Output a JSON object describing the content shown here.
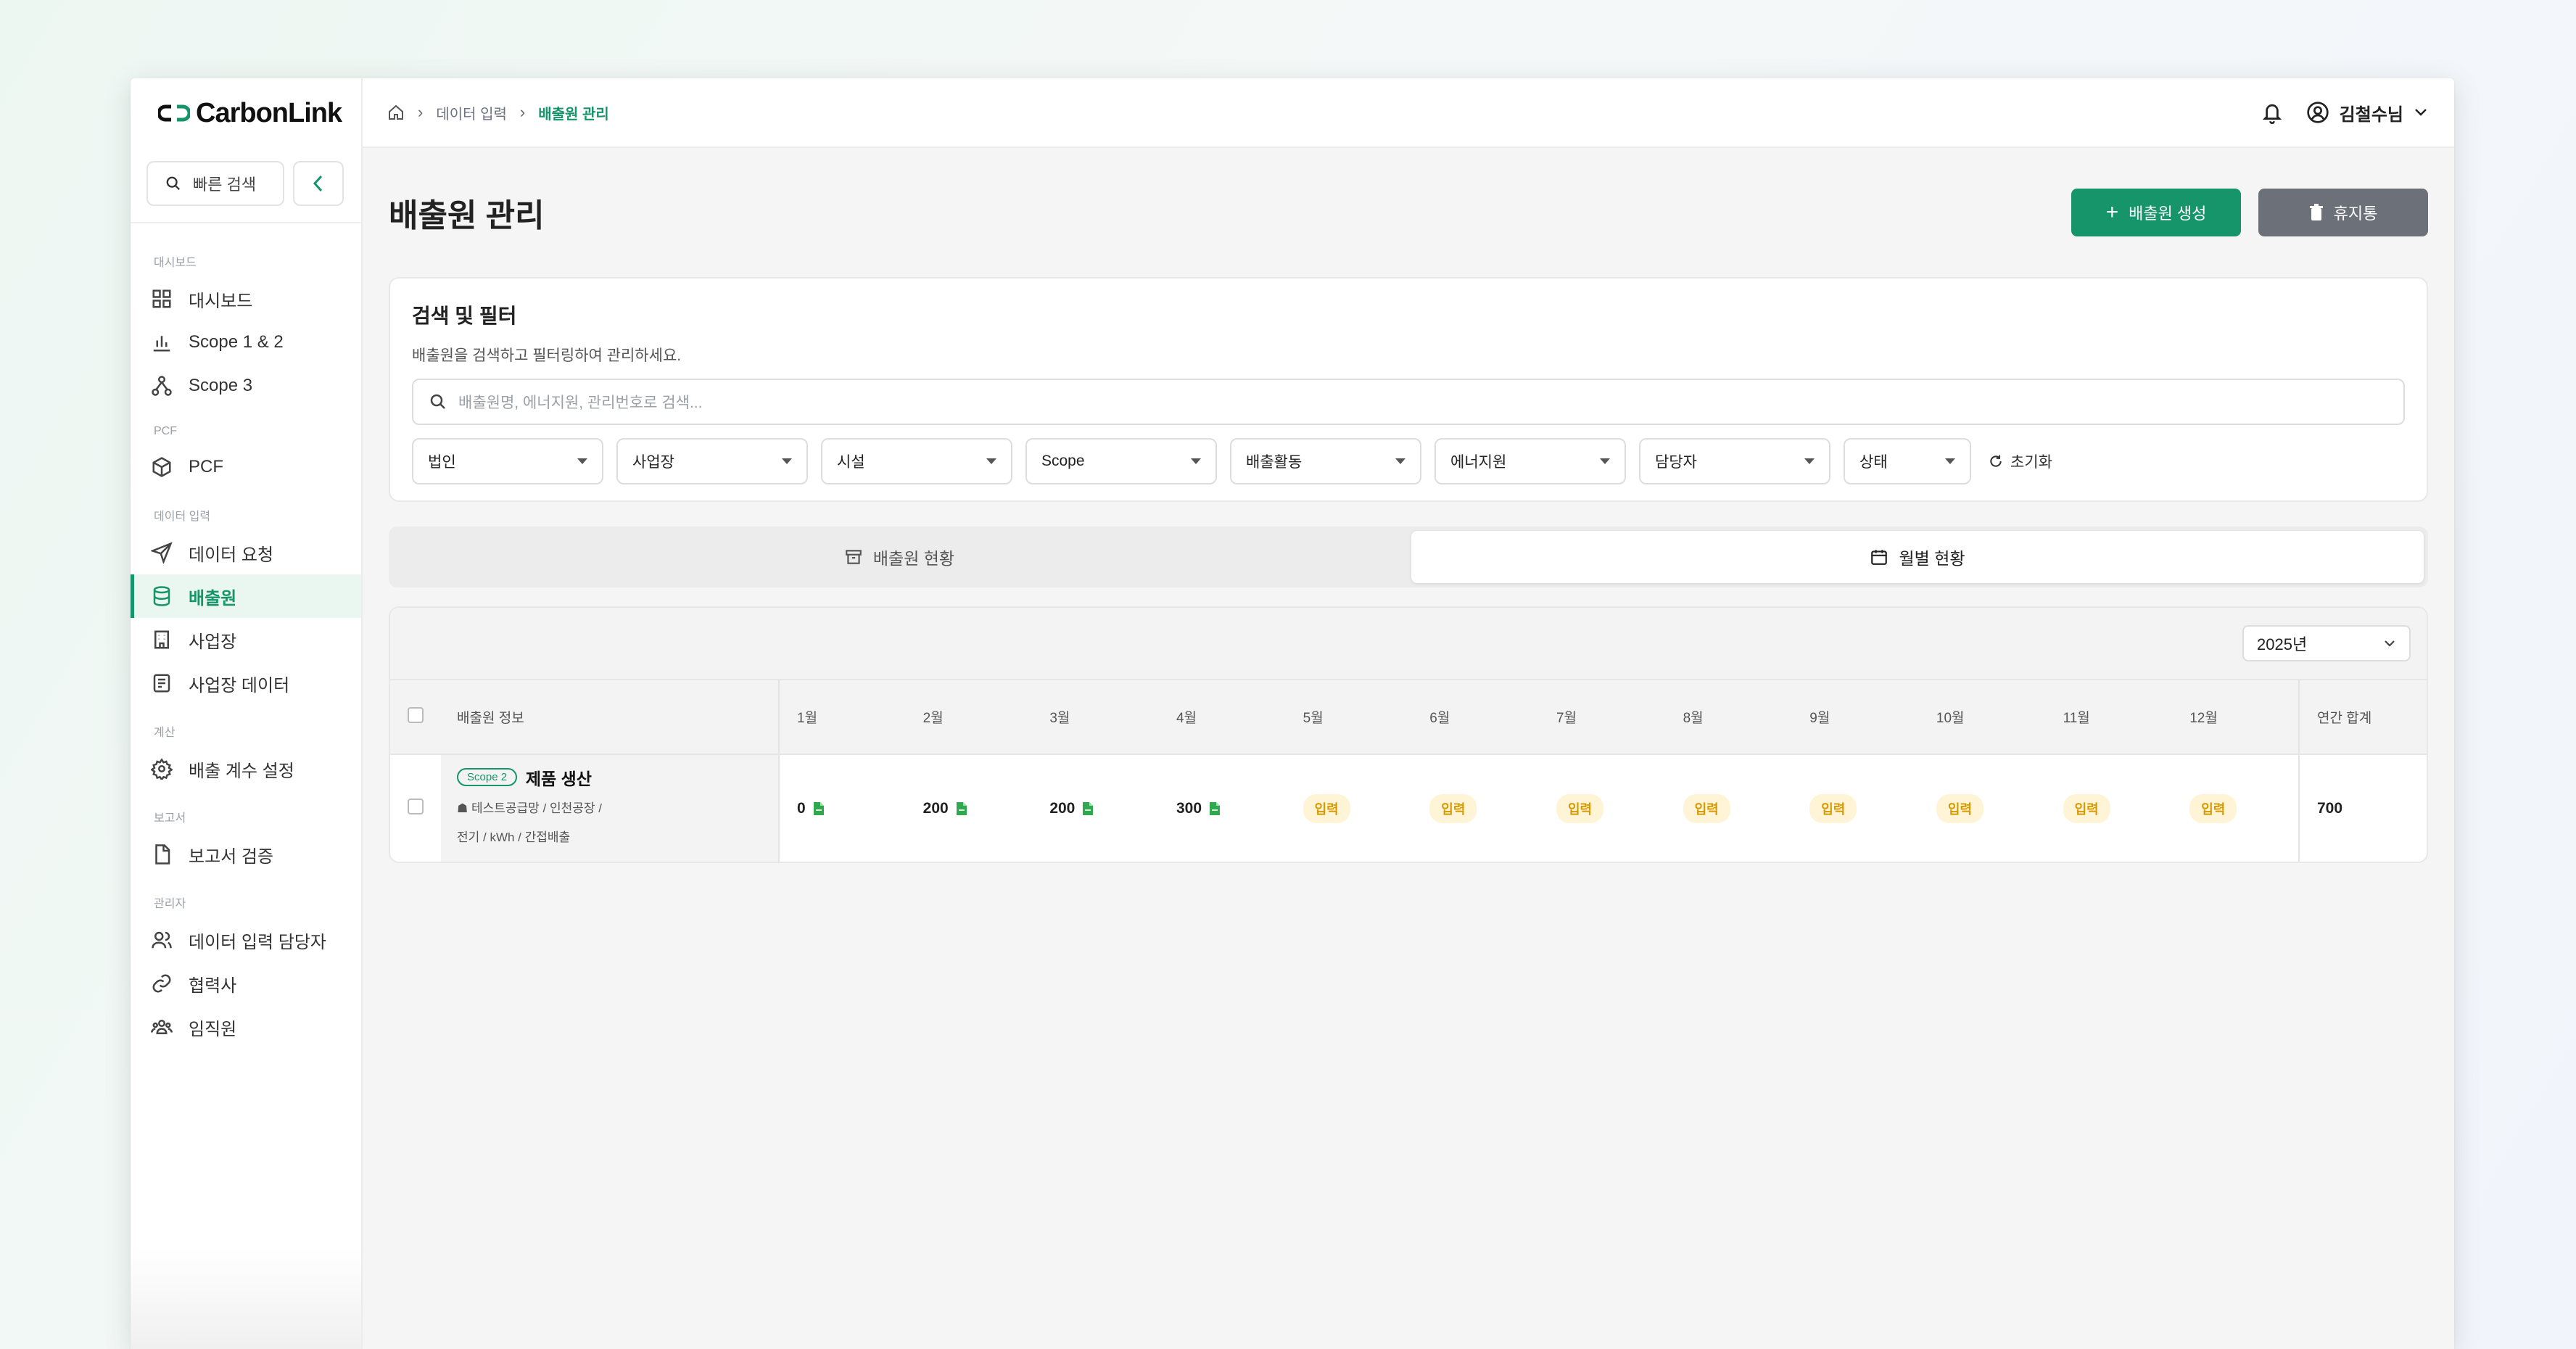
{
  "app": {
    "logo_text": "CarbonLink"
  },
  "sidebar": {
    "quick_search": "빠른 검색",
    "sections": {
      "dashboard": "대시보드",
      "pcf": "PCF",
      "data_input": "데이터 입력",
      "calc": "계산",
      "report": "보고서",
      "admin": "관리자"
    },
    "items": [
      {
        "label": "대시보드",
        "icon": "grid-icon"
      },
      {
        "label": "Scope 1 & 2",
        "icon": "bar-chart-icon"
      },
      {
        "label": "Scope 3",
        "icon": "network-icon"
      },
      {
        "label": "PCF",
        "icon": "cube-icon"
      },
      {
        "label": "데이터 요청",
        "icon": "send-icon"
      },
      {
        "label": "배출원",
        "icon": "database-icon"
      },
      {
        "label": "사업장",
        "icon": "building-icon"
      },
      {
        "label": "사업장 데이터",
        "icon": "building-data-icon"
      },
      {
        "label": "배출 계수 설정",
        "icon": "gear-icon"
      },
      {
        "label": "보고서 검증",
        "icon": "document-icon"
      },
      {
        "label": "데이터 입력 담당자",
        "icon": "users-icon"
      },
      {
        "label": "협력사",
        "icon": "link-icon"
      },
      {
        "label": "임직원",
        "icon": "team-icon"
      }
    ]
  },
  "topbar": {
    "breadcrumb": [
      "데이터 입력",
      "배출원 관리"
    ],
    "user_name": "김철수님"
  },
  "page": {
    "title": "배출원 관리",
    "create_button": "배출원 생성",
    "trash_button": "휴지통"
  },
  "filter": {
    "title": "검색 및 필터",
    "description": "배출원을 검색하고 필터링하여 관리하세요.",
    "search_placeholder": "배출원명, 에너지원, 관리번호로 검색...",
    "selects": [
      "법인",
      "사업장",
      "시설",
      "Scope",
      "배출활동",
      "에너지원",
      "담당자",
      "상태"
    ],
    "reset_label": "초기화"
  },
  "tabs": [
    {
      "label": "배출원 현황",
      "icon": "archive-icon"
    },
    {
      "label": "월별 현황",
      "icon": "calendar-icon"
    }
  ],
  "table": {
    "year": "2025년",
    "headers": {
      "info": "배출원 정보",
      "months": [
        "1월",
        "2월",
        "3월",
        "4월",
        "5월",
        "6월",
        "7월",
        "8월",
        "9월",
        "10월",
        "11월",
        "12월"
      ],
      "total": "연간 합계"
    },
    "rows": [
      {
        "scope": "Scope 2",
        "name": "제품 생산",
        "meta_line1": "테스트공급망 / 인천공장 /",
        "meta_line2": "전기 / kWh / 간접배출",
        "months": [
          "0",
          "200",
          "200",
          "300",
          "입력",
          "입력",
          "입력",
          "입력",
          "입력",
          "입력",
          "입력",
          "입력"
        ],
        "total": "700"
      }
    ]
  },
  "colors": {
    "accent": "#16946a",
    "gray_button": "#6b7079",
    "input_badge_bg": "#fff4d6",
    "input_badge_text": "#d79a00"
  }
}
